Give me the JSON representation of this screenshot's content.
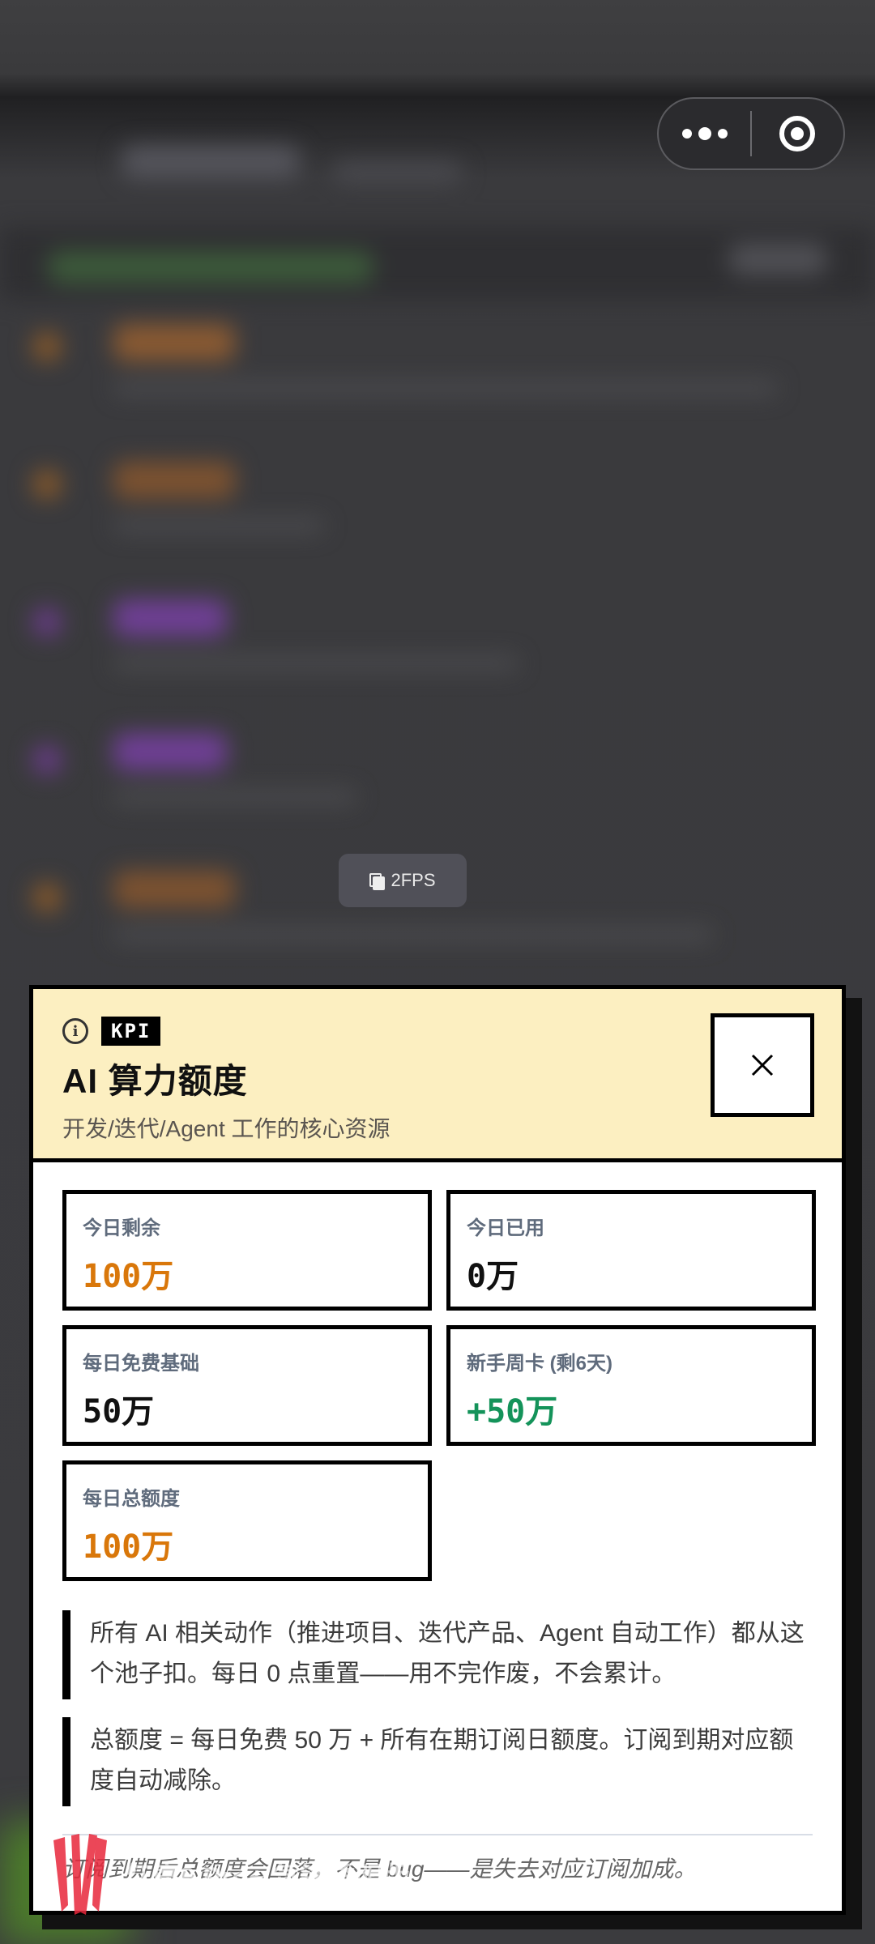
{
  "capsule": {
    "more_icon": "more-dots-icon",
    "close_icon": "record-target-icon"
  },
  "fps_badge": {
    "label": "2FPS"
  },
  "modal": {
    "tag": "KPI",
    "title": "AI 算力额度",
    "subtitle": "开发/迭代/Agent 工作的核心资源",
    "close_icon": "close-icon",
    "stats": [
      {
        "label": "今日剩余",
        "value": "100万",
        "color": "#d9770a"
      },
      {
        "label": "今日已用",
        "value": "0万",
        "color": "#111111"
      },
      {
        "label": "每日免费基础",
        "value": "50万",
        "color": "#111111"
      },
      {
        "label": "新手周卡 (剩6天)",
        "value": "+50万",
        "color": "#14935a"
      },
      {
        "label": "每日总额度",
        "value": "100万",
        "color": "#d9770a"
      }
    ],
    "notes": [
      "所有 AI 相关动作（推进项目、迭代产品、Agent 自动工作）都从这个池子扣。每日 0 点重置——用不完作废，不会累计。",
      "总额度 = 每日免费 50 万 + 所有在期订阅日额度。订阅到期对应额度自动减除。"
    ],
    "footnote": "订阅到期后总额度会回落，不是 bug——是失去对应订阅加成。"
  },
  "watermark": {
    "text": "红魔9 Pro+ 氘锋透明版"
  }
}
